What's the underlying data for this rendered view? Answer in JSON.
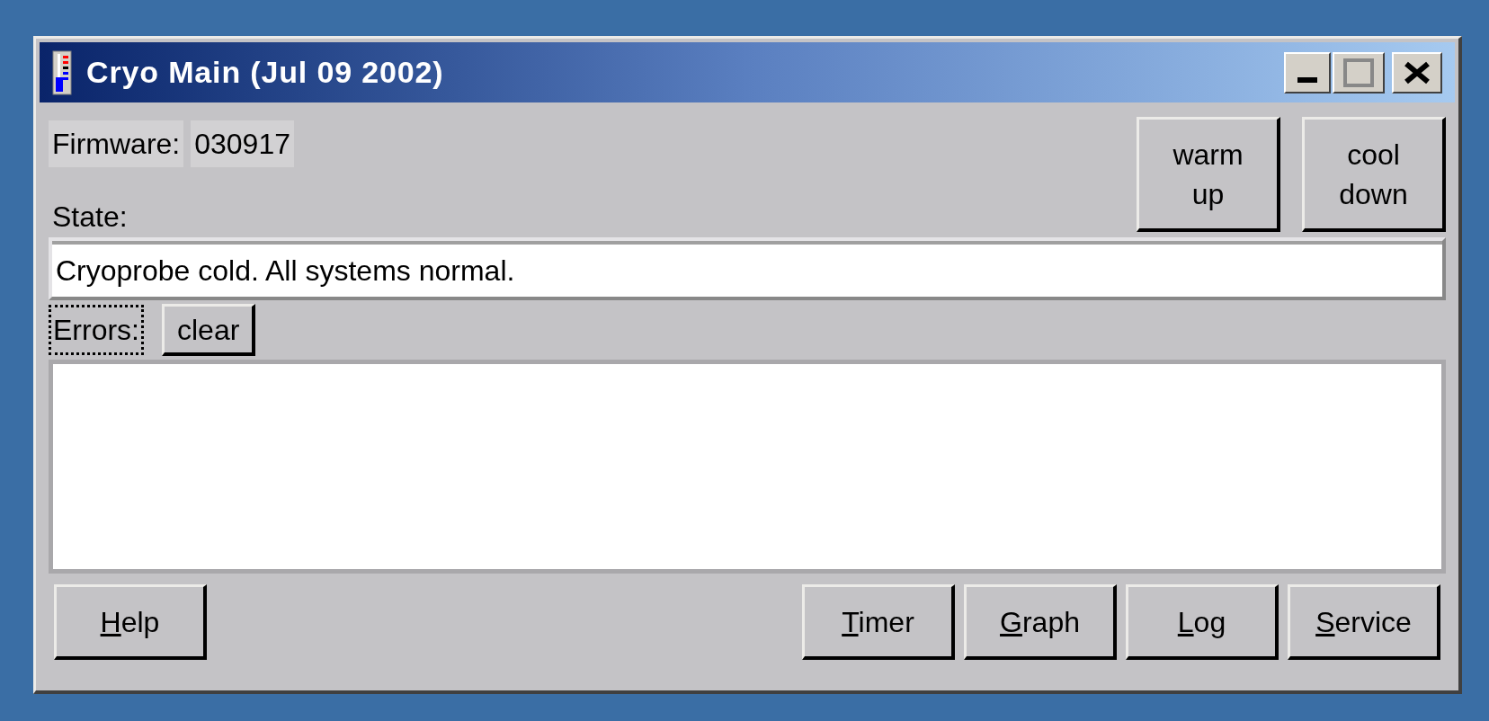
{
  "window": {
    "title": "Cryo Main (Jul 09 2002)"
  },
  "firmware": {
    "label": "Firmware:",
    "value": "030917"
  },
  "mode_buttons": [
    {
      "label": "warm up"
    },
    {
      "label": "cool down"
    }
  ],
  "state": {
    "label": "State:",
    "value": "Cryoprobe cold. All systems normal."
  },
  "errors": {
    "label": "Errors:",
    "focused": true,
    "clear_button": "clear"
  },
  "footer_buttons": [
    {
      "label": "Help",
      "mnemonic_first": true
    },
    {
      "label": "Timer",
      "mnemonic_first": true
    },
    {
      "label": "Graph",
      "mnemonic_first": true
    },
    {
      "label": "Log",
      "mnemonic_first": true
    },
    {
      "label": "Service",
      "mnemonic_first": true
    }
  ]
}
